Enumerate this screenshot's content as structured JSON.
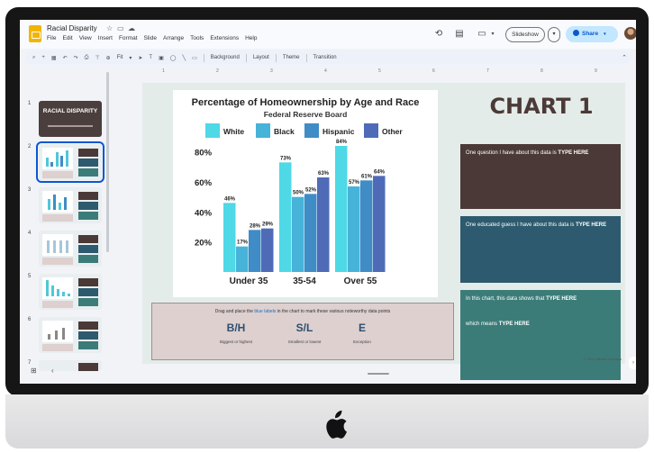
{
  "app": {
    "doc_title": "Racial Disparity",
    "menu": [
      "File",
      "Edit",
      "View",
      "Insert",
      "Format",
      "Slide",
      "Arrange",
      "Tools",
      "Extensions",
      "Help"
    ],
    "slideshow_label": "Slideshow",
    "share_label": "Share",
    "toolbar": {
      "zoom": "Fit",
      "background": "Background",
      "layout": "Layout",
      "theme": "Theme",
      "transition": "Transition"
    },
    "ruler_ticks": [
      "1",
      "2",
      "3",
      "4",
      "5",
      "6",
      "7",
      "8",
      "9"
    ]
  },
  "filmstrip": {
    "slides": [
      {
        "number": "1",
        "title": "RACIAL DISPARITY"
      },
      {
        "number": "2"
      },
      {
        "number": "3"
      },
      {
        "number": "4"
      },
      {
        "number": "5"
      },
      {
        "number": "6"
      },
      {
        "number": "7"
      }
    ]
  },
  "slide": {
    "heading": "CHART 1",
    "box_question": {
      "text": "One question I have about this data is",
      "placeholder": "TYPE HERE"
    },
    "box_guess": {
      "text": "One educated guess I have about this data is",
      "placeholder": "TYPE HERE"
    },
    "box_shows": {
      "text": "In this chart, this data shows that",
      "placeholder": "TYPE HERE"
    },
    "box_means": {
      "text": "which means",
      "placeholder": "TYPE HERE"
    },
    "drag": {
      "instruction_pre": "Drag and place the",
      "instruction_link": "blue labels",
      "instruction_post": "in the chart to mark these various noteworthy data points",
      "labels": [
        {
          "code": "B/H",
          "desc": "Biggest or highest"
        },
        {
          "code": "S/L",
          "desc": "Smallest or lowest"
        },
        {
          "code": "E",
          "desc": "Exception"
        }
      ]
    },
    "credit": "© Let's Cultivate Greatness"
  },
  "chart_data": {
    "type": "bar",
    "title": "Percentage of Homeownership by Age and Race",
    "subtitle": "Federal Reserve Board",
    "categories": [
      "Under 35",
      "35-54",
      "Over 55"
    ],
    "series": [
      {
        "name": "White",
        "values": [
          46,
          73,
          84
        ],
        "color": "#4fd8e6"
      },
      {
        "name": "Black",
        "values": [
          17,
          50,
          57
        ],
        "color": "#47b3d8"
      },
      {
        "name": "Hispanic",
        "values": [
          28,
          52,
          61
        ],
        "color": "#3f8cc6"
      },
      {
        "name": "Other",
        "values": [
          29,
          63,
          64
        ],
        "color": "#4f6bb8"
      }
    ],
    "y_ticks": [
      "20%",
      "40%",
      "60%",
      "80%"
    ],
    "ylim": [
      0,
      90
    ],
    "value_suffix": "%",
    "legend": "top"
  }
}
